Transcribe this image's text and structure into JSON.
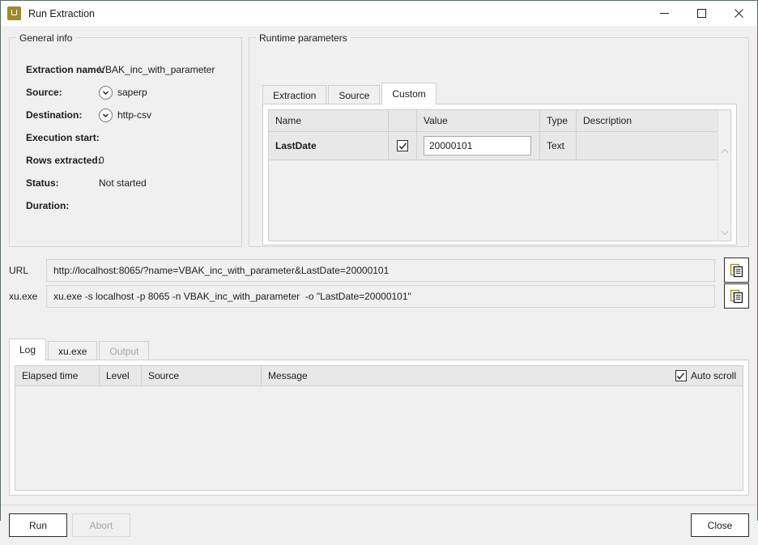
{
  "window": {
    "title": "Run Extraction",
    "icon": "app-u-icon",
    "controls": {
      "minimize": "minimize-icon",
      "maximize": "maximize-icon",
      "close": "close-icon"
    },
    "accent_color": "#9c8b28"
  },
  "general_info": {
    "legend": "General info",
    "rows": [
      {
        "label": "Extraction name:",
        "value": "VBAK_inc_with_parameter",
        "icon": null
      },
      {
        "label": "Source:",
        "value": "saperp",
        "icon": "chevron-down-circle-icon"
      },
      {
        "label": "Destination:",
        "value": "http-csv",
        "icon": "chevron-down-circle-icon"
      },
      {
        "label": "Execution start:",
        "value": "",
        "icon": null
      },
      {
        "label": "Rows extracted:",
        "value": "0",
        "icon": null
      },
      {
        "label": "Status:",
        "value": "Not started",
        "icon": null
      },
      {
        "label": "Duration:",
        "value": "",
        "icon": null
      }
    ]
  },
  "runtime_parameters": {
    "legend": "Runtime parameters",
    "tabs": [
      {
        "label": "Extraction",
        "active": false,
        "disabled": false
      },
      {
        "label": "Source",
        "active": false,
        "disabled": false
      },
      {
        "label": "Custom",
        "active": true,
        "disabled": false
      }
    ],
    "grid": {
      "columns": [
        "Name",
        "",
        "Value",
        "Type",
        "Description"
      ],
      "rows": [
        {
          "name": "LastDate",
          "enabled": true,
          "value": "20000101",
          "type": "Text",
          "description": ""
        }
      ]
    }
  },
  "command_rows": [
    {
      "label": "URL",
      "value": "http://localhost:8065/?name=VBAK_inc_with_parameter&LastDate=20000101",
      "copy_icon": "copy-icon"
    },
    {
      "label": "xu.exe",
      "value": "xu.exe -s localhost -p 8065 -n VBAK_inc_with_parameter  -o \"LastDate=20000101\"",
      "copy_icon": "copy-icon"
    }
  ],
  "log_section": {
    "tabs": [
      {
        "label": "Log",
        "active": true,
        "disabled": false
      },
      {
        "label": "xu.exe",
        "active": false,
        "disabled": false
      },
      {
        "label": "Output",
        "active": false,
        "disabled": true
      }
    ],
    "columns": [
      "Elapsed time",
      "Level",
      "Source",
      "Message"
    ],
    "auto_scroll": {
      "label": "Auto scroll",
      "checked": true
    },
    "rows": []
  },
  "footer": {
    "run_label": "Run",
    "abort_label": "Abort",
    "abort_disabled": true,
    "close_label": "Close"
  }
}
